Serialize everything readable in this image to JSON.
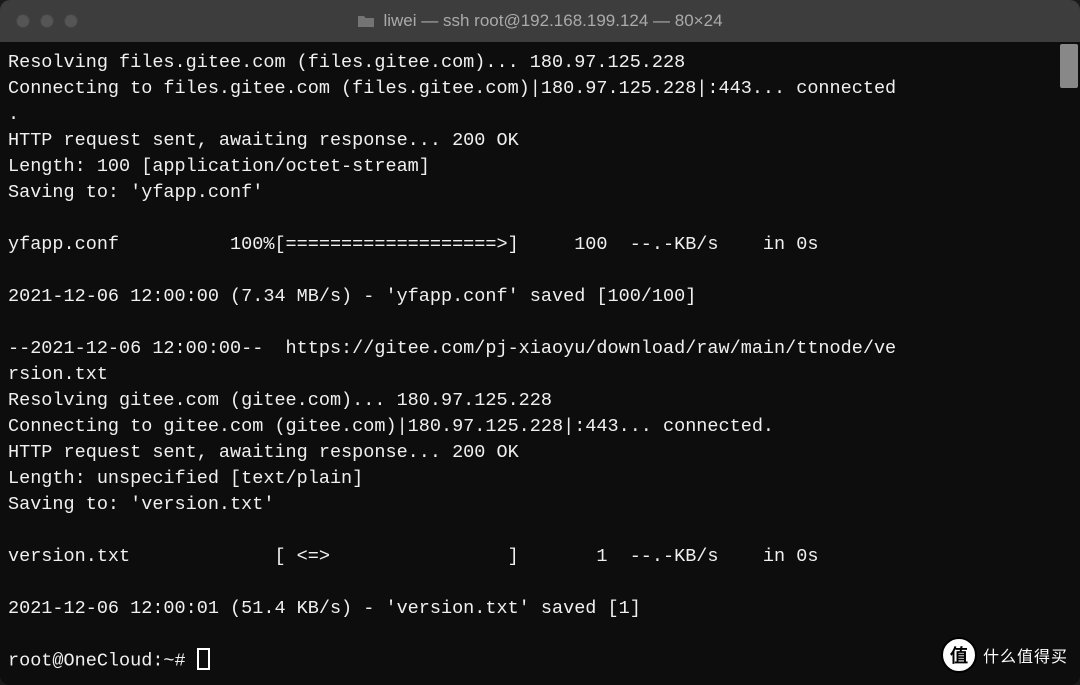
{
  "titlebar": {
    "title": "liwei — ssh root@192.168.199.124 — 80×24"
  },
  "terminal": {
    "lines": [
      "Resolving files.gitee.com (files.gitee.com)... 180.97.125.228",
      "Connecting to files.gitee.com (files.gitee.com)|180.97.125.228|:443... connected",
      ".",
      "HTTP request sent, awaiting response... 200 OK",
      "Length: 100 [application/octet-stream]",
      "Saving to: 'yfapp.conf'",
      "",
      "yfapp.conf          100%[===================>]     100  --.-KB/s    in 0s",
      "",
      "2021-12-06 12:00:00 (7.34 MB/s) - 'yfapp.conf' saved [100/100]",
      "",
      "--2021-12-06 12:00:00--  https://gitee.com/pj-xiaoyu/download/raw/main/ttnode/ve",
      "rsion.txt",
      "Resolving gitee.com (gitee.com)... 180.97.125.228",
      "Connecting to gitee.com (gitee.com)|180.97.125.228|:443... connected.",
      "HTTP request sent, awaiting response... 200 OK",
      "Length: unspecified [text/plain]",
      "Saving to: 'version.txt'",
      "",
      "version.txt             [ <=>                ]       1  --.-KB/s    in 0s",
      "",
      "2021-12-06 12:00:01 (51.4 KB/s) - 'version.txt' saved [1]",
      ""
    ],
    "prompt": "root@OneCloud:~# "
  },
  "watermark": {
    "badge": "值",
    "text": "什么值得买"
  }
}
